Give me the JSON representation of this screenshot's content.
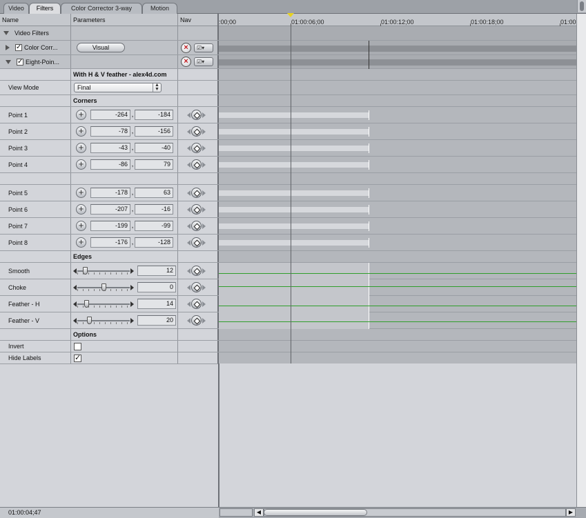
{
  "tabs": [
    {
      "label": "Video",
      "active": false
    },
    {
      "label": "Filters",
      "active": true
    },
    {
      "label": "Color Corrector 3-way",
      "active": false
    },
    {
      "label": "Motion",
      "active": false
    }
  ],
  "columns": {
    "name": "Name",
    "parameters": "Parameters",
    "nav": "Nav"
  },
  "ruler": {
    "labels": [
      ":00;00",
      "01:00:06;00",
      "01:00:12;00",
      "01:00:18;00",
      "01:00:"
    ]
  },
  "video_filters": {
    "label": "Video Filters"
  },
  "color_corrector": {
    "label": "Color Corr...",
    "button": "Visual",
    "enabled": true
  },
  "eight_point": {
    "label": "Eight-Poin...",
    "enabled": true
  },
  "preset_name": "With H & V feather - alex4d.com",
  "view_mode": {
    "label": "View Mode",
    "value": "Final"
  },
  "sections": {
    "corners": "Corners",
    "edges": "Edges",
    "options": "Options"
  },
  "points": [
    {
      "label": "Point 1",
      "x": "-264",
      "y": "-184"
    },
    {
      "label": "Point 2",
      "x": "-78",
      "y": "-156"
    },
    {
      "label": "Point 3",
      "x": "-43",
      "y": "-40"
    },
    {
      "label": "Point 4",
      "x": "-86",
      "y": "79"
    },
    {
      "label": "Point 5",
      "x": "-178",
      "y": "63"
    },
    {
      "label": "Point 6",
      "x": "-207",
      "y": "-16"
    },
    {
      "label": "Point 7",
      "x": "-199",
      "y": "-99"
    },
    {
      "label": "Point 8",
      "x": "-176",
      "y": "-128"
    }
  ],
  "edges": [
    {
      "label": "Smooth",
      "value": "12",
      "level": 0.12
    },
    {
      "label": "Choke",
      "value": "0",
      "level": 0.5
    },
    {
      "label": "Feather - H",
      "value": "14",
      "level": 0.14
    },
    {
      "label": "Feather - V",
      "value": "20",
      "level": 0.2
    }
  ],
  "options": {
    "invert": {
      "label": "Invert",
      "checked": false
    },
    "hide_labels": {
      "label": "Hide Labels",
      "checked": true
    }
  },
  "icons": {
    "close": "close-icon",
    "keyframe": "keyframe-icon",
    "add": "add-point-icon"
  },
  "timecode": "01:00:04;47",
  "colors": {
    "accent": "#2f9e2a",
    "playhead": "#e8d21e",
    "remove": "#c0161b"
  }
}
